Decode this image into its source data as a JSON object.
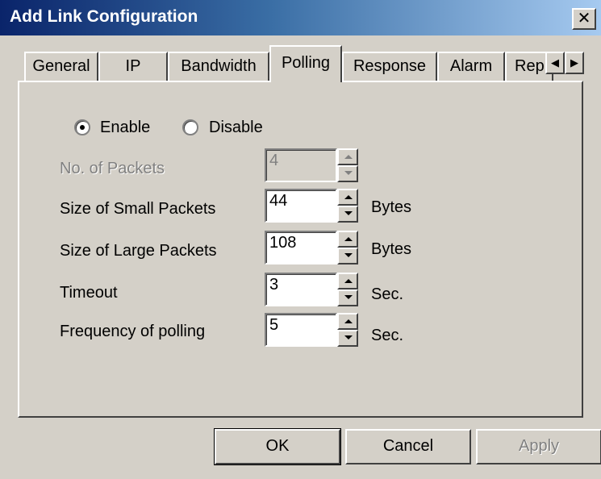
{
  "window": {
    "title": "Add Link Configuration",
    "close_glyph": "✕"
  },
  "tabs": [
    {
      "label": "General",
      "active": false
    },
    {
      "label": "IP",
      "active": false
    },
    {
      "label": "Bandwidth",
      "active": false
    },
    {
      "label": "Polling",
      "active": true
    },
    {
      "label": "Response",
      "active": false
    },
    {
      "label": "Alarm",
      "active": false
    },
    {
      "label": "Rep",
      "active": false
    }
  ],
  "tab_scroll": {
    "left_glyph": "◀",
    "right_glyph": "▶"
  },
  "polling": {
    "mode": {
      "enable_label": "Enable",
      "disable_label": "Disable",
      "selected": "Enable"
    },
    "fields": [
      {
        "label": "No. of Packets",
        "value": "4",
        "unit": "",
        "disabled": true
      },
      {
        "label": "Size of Small Packets",
        "value": "44",
        "unit": "Bytes",
        "disabled": false
      },
      {
        "label": "Size of Large Packets",
        "value": "108",
        "unit": "Bytes",
        "disabled": false
      },
      {
        "label": "Timeout",
        "value": "3",
        "unit": "Sec.",
        "disabled": false
      },
      {
        "label": "Frequency of polling",
        "value": "5",
        "unit": "Sec.",
        "disabled": false
      }
    ]
  },
  "buttons": {
    "ok": "OK",
    "cancel": "Cancel",
    "apply": "Apply"
  }
}
